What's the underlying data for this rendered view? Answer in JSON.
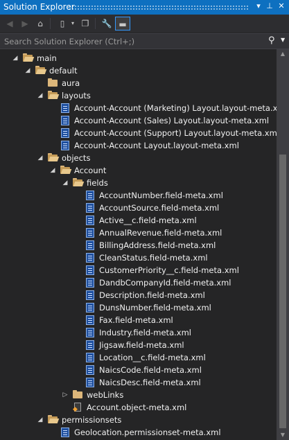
{
  "window": {
    "title": "Solution Explorer",
    "controls": [
      "▾",
      "⊥",
      "✕"
    ]
  },
  "toolbar": {
    "icons": [
      "back-icon",
      "forward-icon",
      "home-icon",
      "switch-views-icon",
      "collapse-all-icon",
      "properties-icon",
      "preview-icon"
    ]
  },
  "search": {
    "placeholder": "Search Solution Explorer (Ctrl+;)"
  },
  "tree": [
    {
      "label": "main",
      "type": "folder",
      "level": 0,
      "expanded": true
    },
    {
      "label": "default",
      "type": "folder",
      "level": 1,
      "expanded": true
    },
    {
      "label": "aura",
      "type": "folder",
      "level": 2,
      "expanded": null
    },
    {
      "label": "layouts",
      "type": "folder",
      "level": 2,
      "expanded": true
    },
    {
      "label": "Account-Account (Marketing) Layout.layout-meta.xml",
      "type": "xml",
      "level": 3
    },
    {
      "label": "Account-Account (Sales) Layout.layout-meta.xml",
      "type": "xml",
      "level": 3
    },
    {
      "label": "Account-Account (Support) Layout.layout-meta.xml",
      "type": "xml",
      "level": 3
    },
    {
      "label": "Account-Account Layout.layout-meta.xml",
      "type": "xml",
      "level": 3
    },
    {
      "label": "objects",
      "type": "folder",
      "level": 2,
      "expanded": true
    },
    {
      "label": "Account",
      "type": "folder",
      "level": 3,
      "expanded": true
    },
    {
      "label": "fields",
      "type": "folder",
      "level": 4,
      "expanded": true
    },
    {
      "label": "AccountNumber.field-meta.xml",
      "type": "xml",
      "level": 5
    },
    {
      "label": "AccountSource.field-meta.xml",
      "type": "xml",
      "level": 5
    },
    {
      "label": "Active__c.field-meta.xml",
      "type": "xml",
      "level": 5
    },
    {
      "label": "AnnualRevenue.field-meta.xml",
      "type": "xml",
      "level": 5
    },
    {
      "label": "BillingAddress.field-meta.xml",
      "type": "xml",
      "level": 5
    },
    {
      "label": "CleanStatus.field-meta.xml",
      "type": "xml",
      "level": 5
    },
    {
      "label": "CustomerPriority__c.field-meta.xml",
      "type": "xml",
      "level": 5
    },
    {
      "label": "DandbCompanyId.field-meta.xml",
      "type": "xml",
      "level": 5
    },
    {
      "label": "Description.field-meta.xml",
      "type": "xml",
      "level": 5
    },
    {
      "label": "DunsNumber.field-meta.xml",
      "type": "xml",
      "level": 5
    },
    {
      "label": "Fax.field-meta.xml",
      "type": "xml",
      "level": 5
    },
    {
      "label": "Industry.field-meta.xml",
      "type": "xml",
      "level": 5
    },
    {
      "label": "Jigsaw.field-meta.xml",
      "type": "xml",
      "level": 5
    },
    {
      "label": "Location__c.field-meta.xml",
      "type": "xml",
      "level": 5
    },
    {
      "label": "NaicsCode.field-meta.xml",
      "type": "xml",
      "level": 5
    },
    {
      "label": "NaicsDesc.field-meta.xml",
      "type": "xml",
      "level": 5
    },
    {
      "label": "webLinks",
      "type": "folder",
      "level": 4,
      "expanded": false
    },
    {
      "label": "Account.object-meta.xml",
      "type": "object",
      "level": 4
    },
    {
      "label": "permissionsets",
      "type": "folder",
      "level": 2,
      "expanded": true
    },
    {
      "label": "Geolocation.permissionset-meta.xml",
      "type": "xml",
      "level": 3
    }
  ],
  "scrollbar": {
    "position_fraction": 0.27,
    "visible_fraction": 0.73
  }
}
